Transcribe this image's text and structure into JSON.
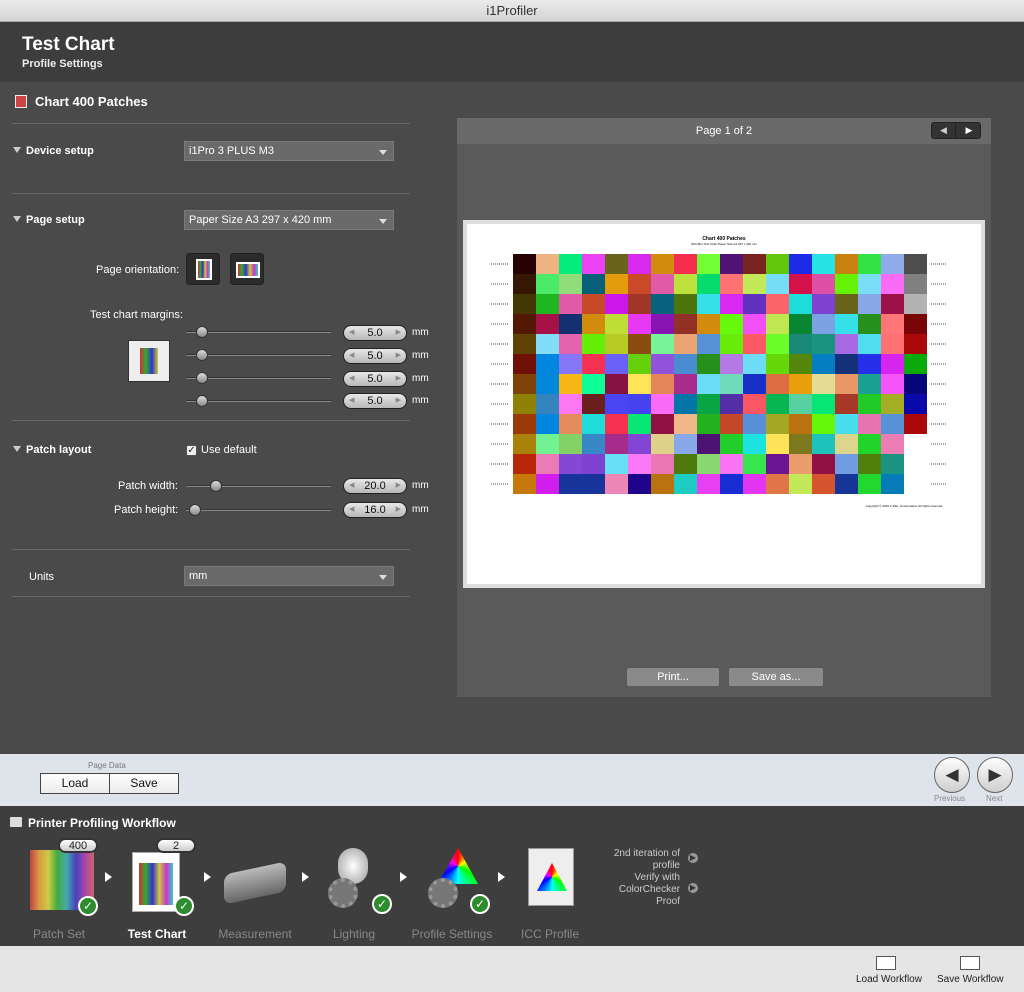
{
  "window": {
    "title": "i1Profiler"
  },
  "header": {
    "title": "Test Chart",
    "subtitle": "Profile Settings"
  },
  "section": {
    "title": "Chart 400 Patches"
  },
  "device_setup": {
    "label": "Device setup",
    "value": "i1Pro 3 PLUS M3"
  },
  "page_setup": {
    "label": "Page setup",
    "value": "Paper Size A3  297 x 420 mm",
    "orientation_label": "Page orientation:"
  },
  "margins": {
    "label": "Test chart margins:",
    "values": [
      "5.0",
      "5.0",
      "5.0",
      "5.0"
    ],
    "unit": "mm"
  },
  "patch_layout": {
    "label": "Patch layout",
    "use_default_label": "Use default",
    "use_default_checked": true,
    "width_label": "Patch width:",
    "width_value": "20.0",
    "height_label": "Patch height:",
    "height_value": "16.0",
    "unit": "mm"
  },
  "units": {
    "label": "Units",
    "value": "mm"
  },
  "preview": {
    "page_label": "Page 1 of 2",
    "print_label": "Print...",
    "save_as_label": "Save as...",
    "chart_title": "Chart 400 Patches",
    "chart_subtitle": "i1Profiler Test Chart  Paper Size A3 297 x 420 mm",
    "copyright": "Copyright © 2019 X-Rite, Incorporated. All rights reserved."
  },
  "page_data": {
    "label": "Page Data",
    "load_label": "Load",
    "save_label": "Save"
  },
  "nav": {
    "previous_label": "Previous",
    "next_label": "Next"
  },
  "workflow": {
    "title": "Printer Profiling Workflow",
    "steps": [
      {
        "label": "Patch Set",
        "badge": "400",
        "done": true
      },
      {
        "label": "Test Chart",
        "badge": "2",
        "done": true,
        "active": true
      },
      {
        "label": "Measurement",
        "done": false
      },
      {
        "label": "Lighting",
        "done": true
      },
      {
        "label": "Profile Settings",
        "done": true
      },
      {
        "label": "ICC Profile",
        "done": false
      }
    ],
    "note1": "2nd iteration of profile",
    "note2": "Verify with ColorChecker Proof"
  },
  "footer": {
    "load_workflow_label": "Load Workflow",
    "save_workflow_label": "Save Workflow"
  }
}
